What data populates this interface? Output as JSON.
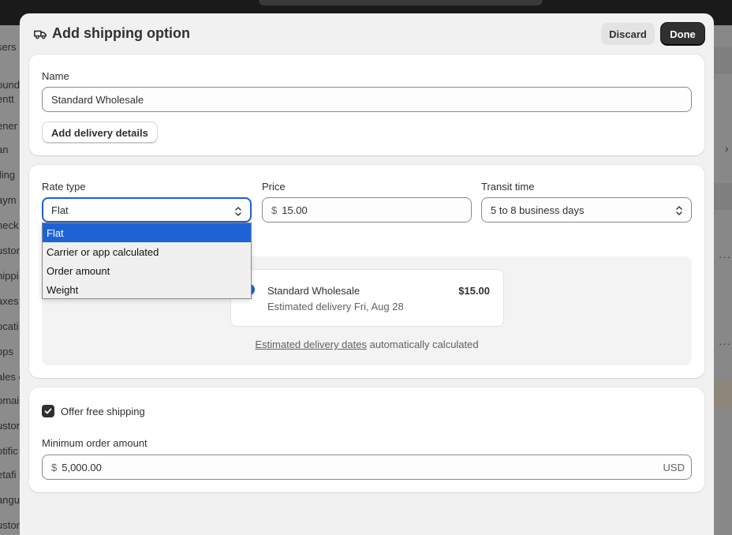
{
  "background": {
    "sidebar_items": [
      "sers",
      "ound",
      "entt",
      "ener",
      "an",
      "lling",
      "aym",
      "heck",
      "ustor",
      "hippi",
      "axes",
      "ocati",
      "ops",
      "ales c",
      "omai",
      "ustor",
      "otific",
      "etafi",
      "angu",
      "ustor"
    ]
  },
  "modal": {
    "title": "Add shipping option",
    "discard_label": "Discard",
    "done_label": "Done"
  },
  "name_card": {
    "name_label": "Name",
    "name_value": "Standard Wholesale",
    "add_delivery_details_label": "Add delivery details"
  },
  "rate_card": {
    "rate_type_label": "Rate type",
    "rate_type_value": "Flat",
    "rate_type_options": [
      "Flat",
      "Carrier or app calculated",
      "Order amount",
      "Weight"
    ],
    "price_label": "Price",
    "price_prefix": "$",
    "price_value": "15.00",
    "transit_label": "Transit time",
    "transit_value": "5 to 8 business days",
    "preview": {
      "name": "Standard Wholesale",
      "price": "$15.00",
      "estimated_delivery": "Estimated delivery Fri, Aug 28",
      "footer_link": "Estimated delivery dates",
      "footer_text": " automatically calculated"
    }
  },
  "free_shipping_card": {
    "checkbox_label": "Offer free shipping",
    "checked": true,
    "min_order_label": "Minimum order amount",
    "min_order_prefix": "$",
    "min_order_value": "5,000.00",
    "min_order_suffix": "USD"
  },
  "colors": {
    "accent": "#303030",
    "selected_option": "#1e63d6",
    "radio": "#1e5fd6"
  }
}
